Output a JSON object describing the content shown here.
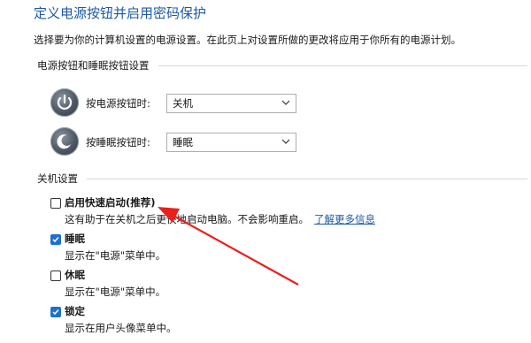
{
  "header": {
    "title": "定义电源按钮并启用密码保护",
    "description": "选择要为你的计算机设置的电源设置。在此页上对设置所做的更改将应用于你所有的电源计划。"
  },
  "buttons_group": {
    "title": "电源按钮和睡眠按钮设置",
    "power_button": {
      "label": "按电源按钮时:",
      "value": "关机",
      "icon": "power-button-icon"
    },
    "sleep_button": {
      "label": "按睡眠按钮时:",
      "value": "睡眠",
      "icon": "sleep-button-icon"
    }
  },
  "shutdown_group": {
    "title": "关机设置",
    "options": [
      {
        "label": "启用快速启动(推荐)",
        "checked": false,
        "desc": "这有助于在关机之后更快地启动电脑。不会影响重启。",
        "link": "了解更多信息"
      },
      {
        "label": "睡眠",
        "checked": true,
        "desc": "显示在\"电源\"菜单中。"
      },
      {
        "label": "休眠",
        "checked": false,
        "desc": "显示在\"电源\"菜单中。"
      },
      {
        "label": "锁定",
        "checked": true,
        "desc": "显示在用户头像菜单中。"
      }
    ]
  },
  "annotation": {
    "arrow_color": "#e8201e"
  },
  "colors": {
    "accent": "#1c5aa6",
    "checkbox": "#1f6fd1"
  }
}
